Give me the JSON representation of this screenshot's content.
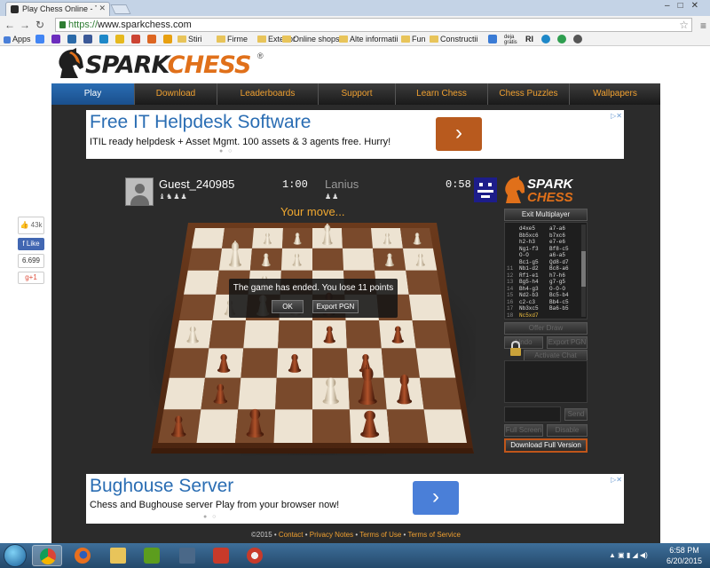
{
  "browser": {
    "tab_title": "Play Chess Online - The P",
    "url_scheme": "https://",
    "url_rest": "www.sparkchess.com",
    "bookmarks": [
      "Apps",
      "Stiri",
      "Firme",
      "Exterior",
      "Online shops",
      "Alte informatii",
      "Fun",
      "Constructii"
    ],
    "small_bookmarks": [
      "deja",
      "gratis",
      "RI"
    ]
  },
  "site": {
    "logo_part1": "SPARK",
    "logo_part2": "CHESS",
    "registered": "®",
    "nav": [
      "Play",
      "Download",
      "Leaderboards",
      "Support",
      "Learn Chess",
      "Chess Puzzles",
      "Wallpapers"
    ],
    "active_nav": "Play"
  },
  "ads": {
    "top": {
      "title": "Free IT Helpdesk Software",
      "subtitle": "ITIL ready helpdesk + Asset Mgmt. 100 assets & 3 agents free. Hurry!",
      "button": "›",
      "button_color": "#b85a1e"
    },
    "bottom": {
      "title": "Bughouse Server",
      "subtitle": "Chess and Bughouse server Play from your browser now!",
      "button": "›",
      "button_color": "#4a7fd8"
    },
    "close_mark": "▷✕",
    "pager_dots": "● ○"
  },
  "game": {
    "player1": {
      "name": "Guest_240985",
      "clock": "1:00",
      "captured": "♝♞♟♟"
    },
    "player2": {
      "name": "Lanius",
      "clock": "0:58",
      "captured": "♟♟"
    },
    "logo_line1": "SPARK",
    "logo_line2": "CHESS",
    "status": "Your move...",
    "dialog": {
      "message": "The game has ended. You lose 11 points",
      "ok": "OK",
      "export": "Export PGN"
    }
  },
  "panel": {
    "exit_button": "Exit Multiplayer",
    "moves": [
      {
        "n": "",
        "w": "d4xe5",
        "b": "a7-a6"
      },
      {
        "n": "",
        "w": "Bb5xc6",
        "b": "b7xc6"
      },
      {
        "n": "",
        "w": "h2-h3",
        "b": "e7-e6"
      },
      {
        "n": "",
        "w": "Ng1-f3",
        "b": "Bf8-c5"
      },
      {
        "n": "",
        "w": "O-O",
        "b": "a6-a5"
      },
      {
        "n": "",
        "w": "Bc1-g5",
        "b": "Qd8-d7"
      },
      {
        "n": "11",
        "w": "Nb1-d2",
        "b": "Bc8-a6"
      },
      {
        "n": "12",
        "w": "Rf1-e1",
        "b": "h7-h6"
      },
      {
        "n": "13",
        "w": "Bg5-h4",
        "b": "g7-g5"
      },
      {
        "n": "14",
        "w": "Bh4-g3",
        "b": "O-O-O"
      },
      {
        "n": "15",
        "w": "Nd2-b3",
        "b": "Bc5-b4"
      },
      {
        "n": "16",
        "w": "c2-c3",
        "b": "Bb4-c5"
      },
      {
        "n": "17",
        "w": "Nb3xc5",
        "b": "Ba6-b5"
      },
      {
        "n": "18",
        "w": "Nc5xd7",
        "b": ""
      }
    ],
    "offer_draw": "Offer Draw",
    "undo": "Undo",
    "export_pgn": "Export PGN",
    "activate_chat": "Activate Chat",
    "send": "Send",
    "full_screen": "Full Screen",
    "disable": "Disable",
    "download_full": "Download Full Version"
  },
  "social": {
    "likes": "43k",
    "like_button": "Like",
    "count": "6.699",
    "gplus": "g+1"
  },
  "footer": {
    "copyright": "©2015 • ",
    "links": [
      "Contact",
      "Privacy Notes",
      "Terms of Use",
      "Terms of Service"
    ]
  },
  "taskbar": {
    "time": "6:58 PM",
    "date": "6/20/2015"
  },
  "colors": {
    "accent_orange": "#f0a030",
    "nav_active": "#2a6db3",
    "board_light": "#ede3d2",
    "board_dark": "#7a4a2c"
  }
}
